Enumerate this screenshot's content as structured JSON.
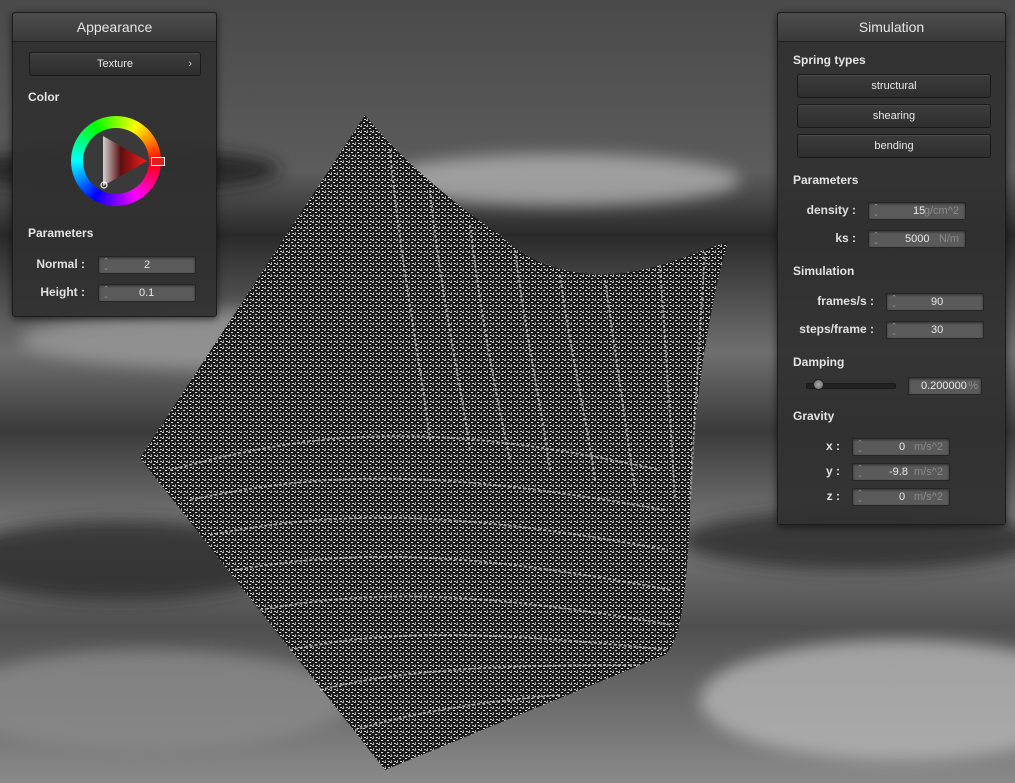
{
  "appearance": {
    "title": "Appearance",
    "shader_button": "Texture",
    "color_label": "Color",
    "parameters_label": "Parameters",
    "normal_label": "Normal :",
    "normal_value": "2",
    "height_label": "Height :",
    "height_value": "0.1",
    "selected_color": "#ff1a1a"
  },
  "simulation": {
    "title": "Simulation",
    "spring_types_label": "Spring types",
    "spring_buttons": [
      "structural",
      "shearing",
      "bending"
    ],
    "parameters_label": "Parameters",
    "density_label": "density :",
    "density_value": "15",
    "density_unit": "g/cm^2",
    "ks_label": "ks :",
    "ks_value": "5000",
    "ks_unit": "N/m",
    "sim_label": "Simulation",
    "fps_label": "frames/s :",
    "fps_value": "90",
    "steps_label": "steps/frame :",
    "steps_value": "30",
    "damping_label": "Damping",
    "damping_value": "0.200000",
    "damping_unit": "%",
    "damping_slider_fraction": 0.2,
    "gravity_label": "Gravity",
    "gx_label": "x :",
    "gx_value": "0",
    "gy_label": "y :",
    "gy_value": "-9.8",
    "gz_label": "z :",
    "gz_value": "0",
    "gravity_unit": "m/s^2"
  }
}
